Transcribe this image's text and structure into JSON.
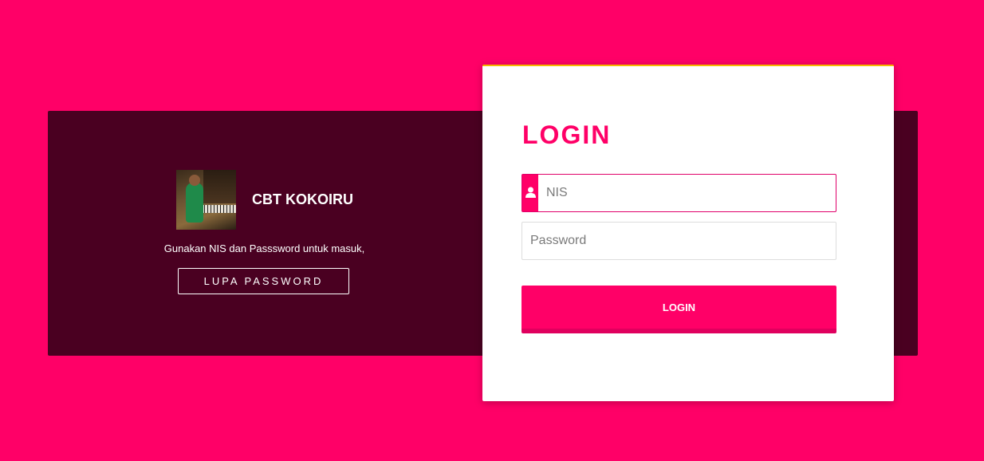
{
  "brand": {
    "name": "CBT KOKOIRU",
    "subtitle": "Gunakan NIS dan Passsword untuk masuk,",
    "forgot_label": "LUPA PASSWORD"
  },
  "login": {
    "title": "LOGIN",
    "nis_placeholder": "NIS",
    "password_placeholder": "Password",
    "submit_label": "LOGIN"
  },
  "colors": {
    "background": "#ff0067",
    "panel": "#4a0021",
    "accent": "#ff0067",
    "card_top_border": "#f5b800"
  },
  "icons": {
    "user_field_icon": "user-icon"
  }
}
